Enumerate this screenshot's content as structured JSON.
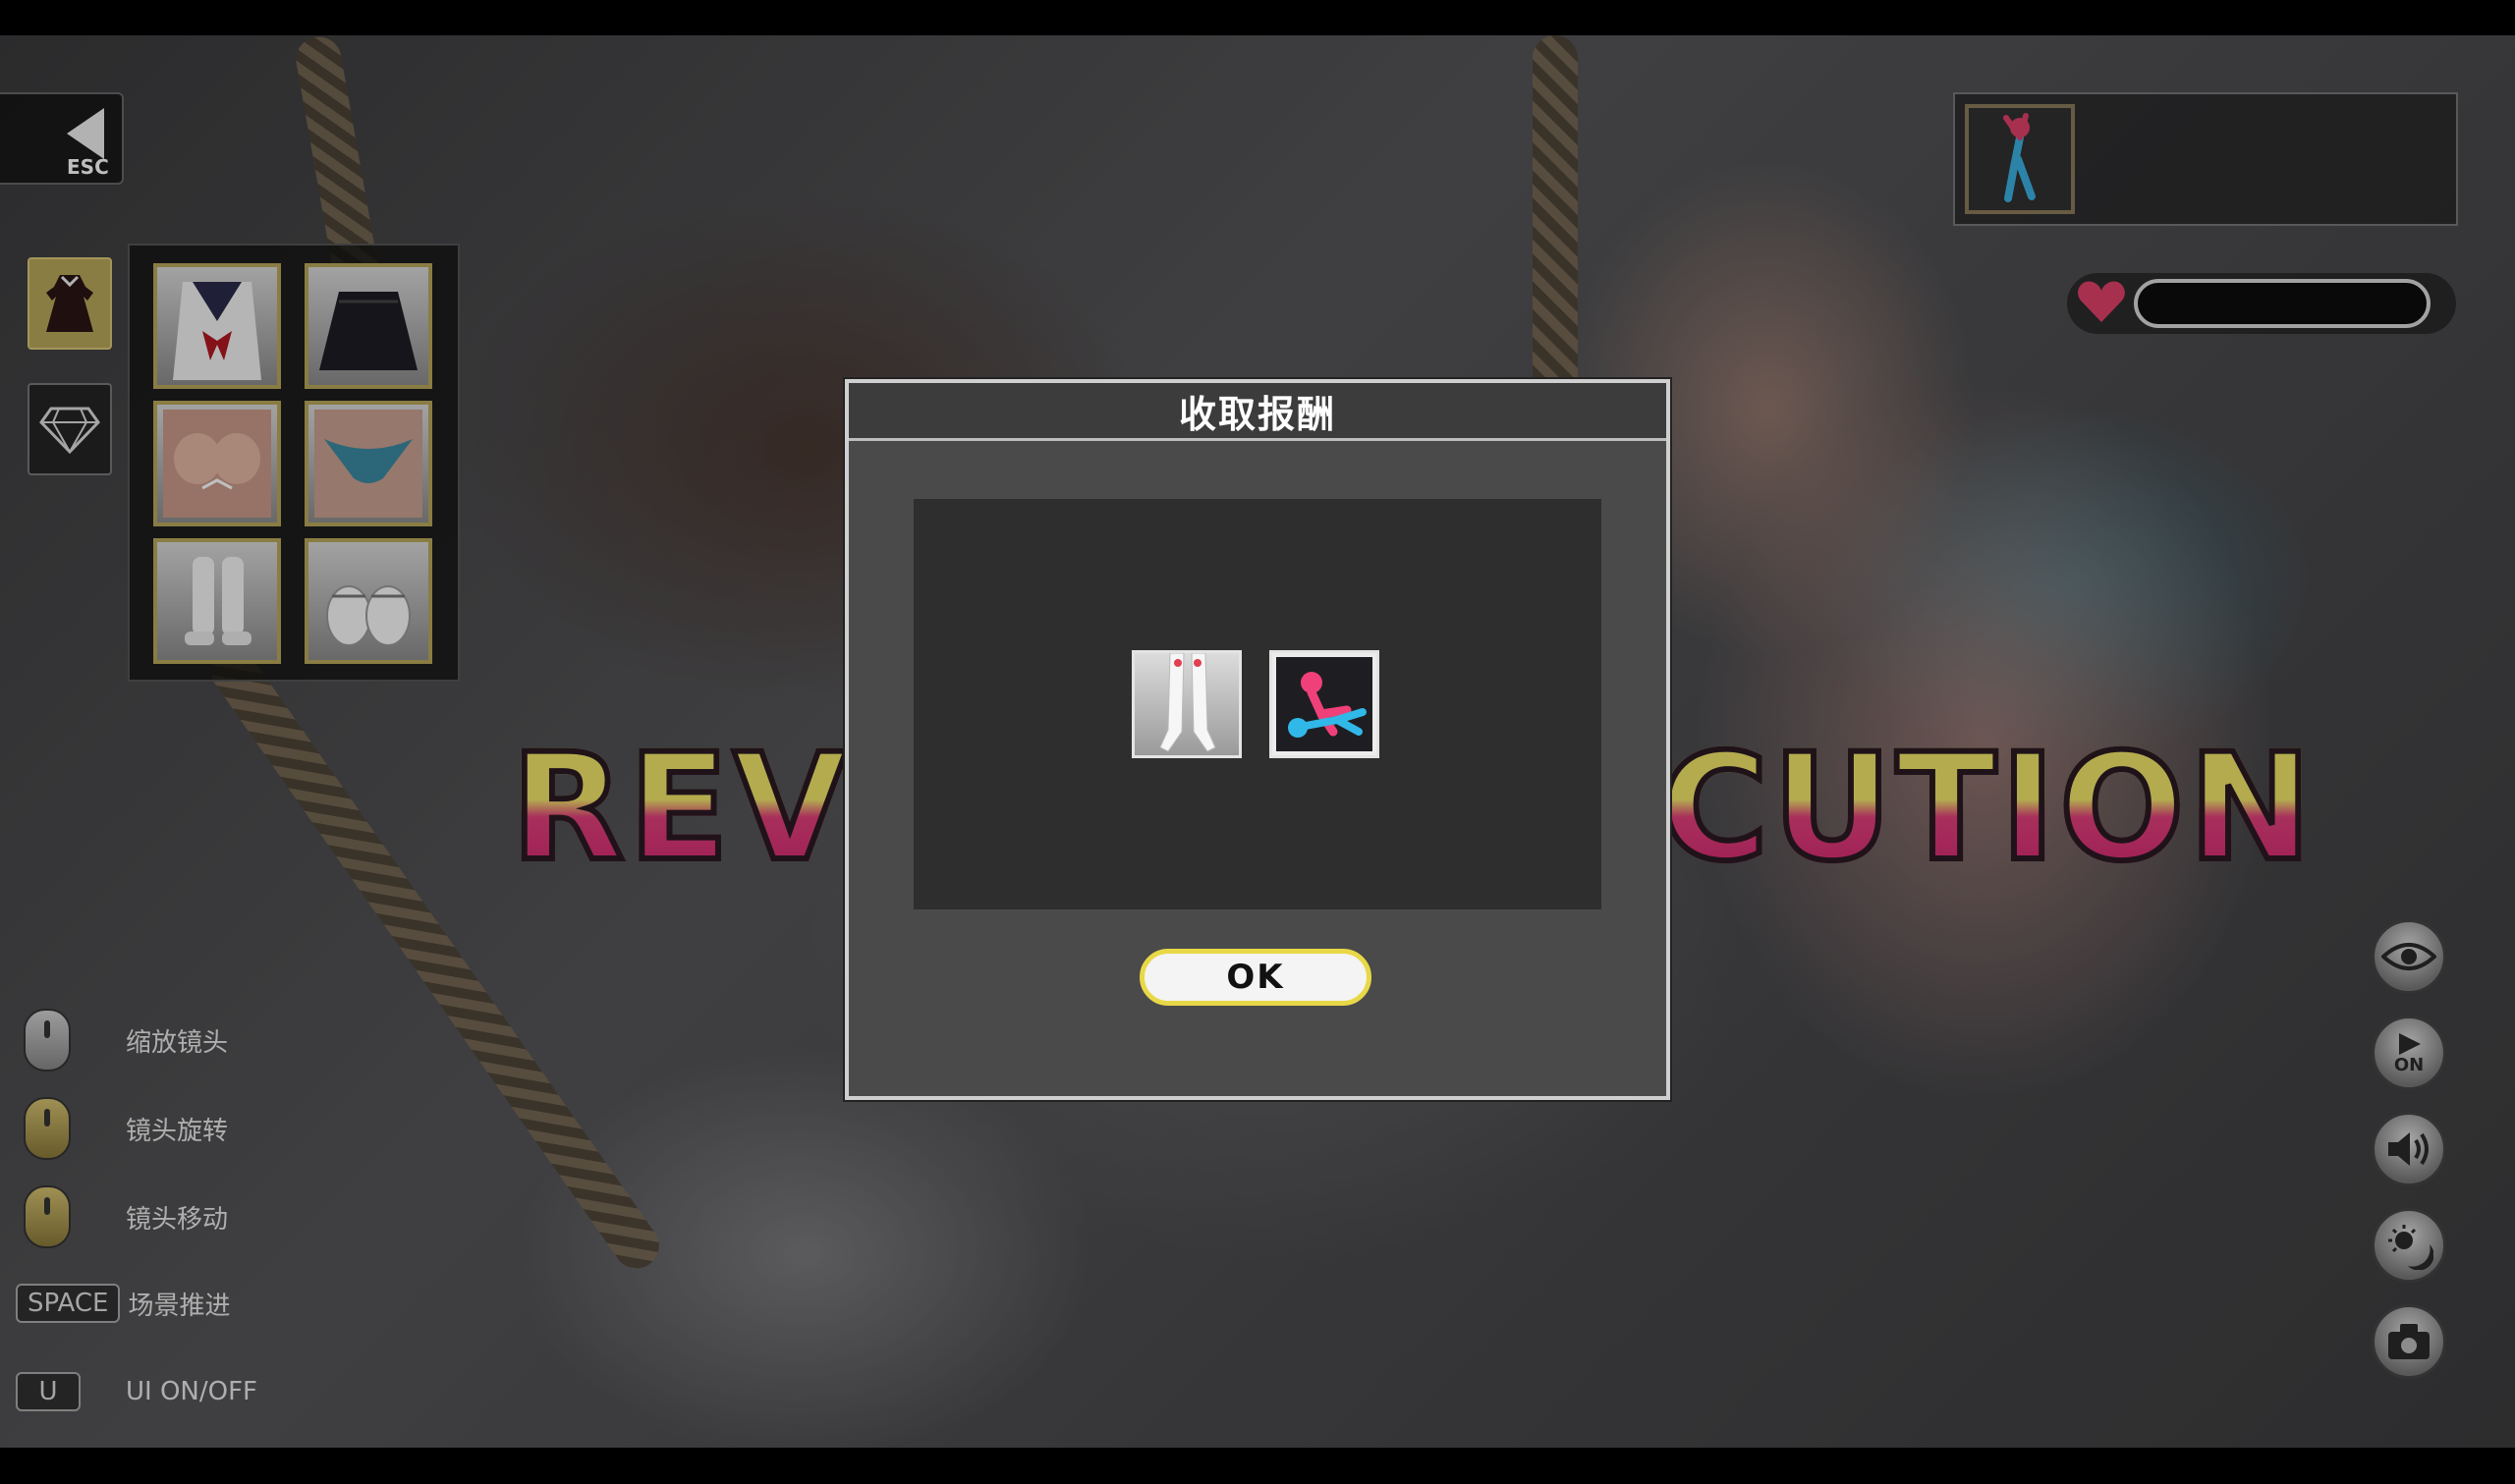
{
  "top_left": {
    "esc_label": "ESC"
  },
  "wardrobe": {
    "tabs": [
      {
        "icon": "dress-icon",
        "active": true
      },
      {
        "icon": "diamond-icon",
        "active": false
      }
    ],
    "slots": [
      {
        "icon": "sailor-top-icon"
      },
      {
        "icon": "skirt-icon"
      },
      {
        "icon": "bra-icon"
      },
      {
        "icon": "panties-icon"
      },
      {
        "icon": "socks-icon"
      },
      {
        "icon": "shoes-icon"
      }
    ]
  },
  "background_title": {
    "left_part": "REV",
    "right_part": "CUTION"
  },
  "status": {
    "heart_icon": "heart-icon",
    "affection_fill": 0.0
  },
  "controls": [
    {
      "icon": "mouse-wheel-icon",
      "label": "缩放镜头"
    },
    {
      "icon": "mouse-left-drag-icon",
      "label": "镜头旋转"
    },
    {
      "icon": "mouse-right-drag-icon",
      "label": "镜头移动"
    },
    {
      "key": "SPACE",
      "label": "场景推进"
    },
    {
      "key": "U",
      "label": "UI ON/OFF"
    }
  ],
  "right_buttons": [
    {
      "icon": "eye-icon"
    },
    {
      "icon": "play-on-icon",
      "label": "ON"
    },
    {
      "icon": "speaker-icon"
    },
    {
      "icon": "day-night-icon"
    },
    {
      "icon": "camera-icon"
    }
  ],
  "modal": {
    "title": "收取报酬",
    "rewards": [
      {
        "icon": "stockings-reward-icon"
      },
      {
        "icon": "pose-reward-icon"
      }
    ],
    "ok_label": "OK"
  },
  "colors": {
    "accent_gold": "#b9a75a",
    "ok_border": "#e8d848",
    "heart": "#e0406a"
  }
}
